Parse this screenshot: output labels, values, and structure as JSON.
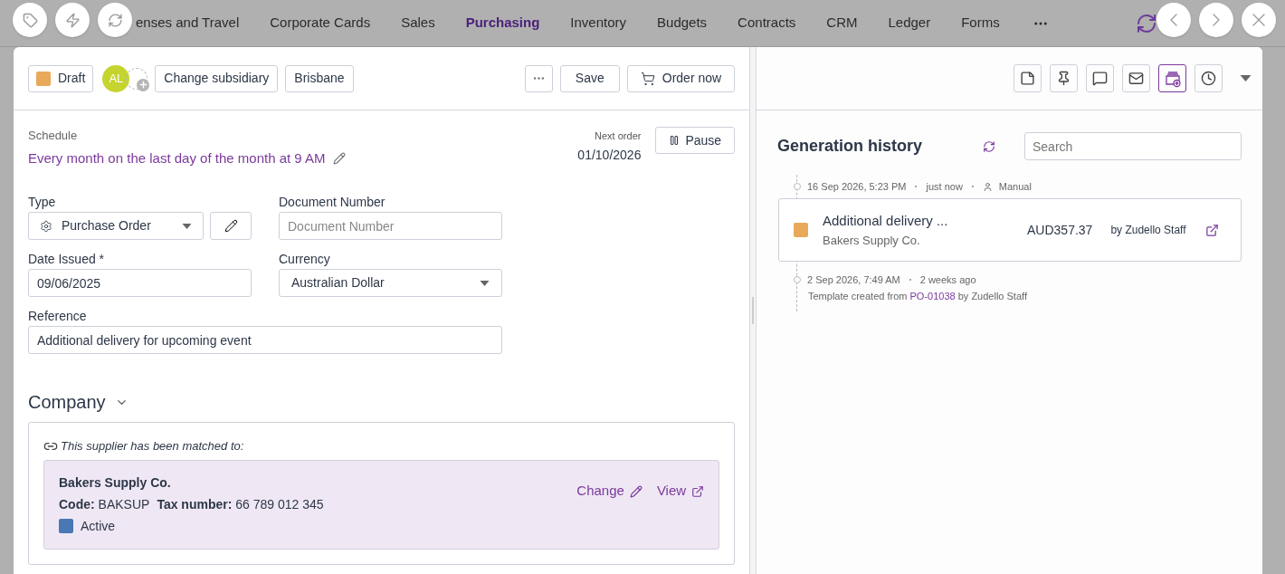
{
  "nav": {
    "items": [
      {
        "label": "enses and Travel",
        "selected": false
      },
      {
        "label": "Corporate Cards",
        "selected": false
      },
      {
        "label": "Sales",
        "selected": false
      },
      {
        "label": "Purchasing",
        "selected": true
      },
      {
        "label": "Inventory",
        "selected": false
      },
      {
        "label": "Budgets",
        "selected": false
      },
      {
        "label": "Contracts",
        "selected": false
      },
      {
        "label": "CRM",
        "selected": false
      },
      {
        "label": "Ledger",
        "selected": false
      },
      {
        "label": "Forms",
        "selected": false
      }
    ]
  },
  "header": {
    "status": {
      "label": "Draft",
      "color": "#e8a95b"
    },
    "avatar": "AL",
    "buttons": [
      "Change subsidiary",
      "Brisbane"
    ],
    "save": "Save",
    "order": "Order now"
  },
  "toolbar": [
    {
      "kind": "note",
      "selected": false
    },
    {
      "kind": "pin",
      "selected": false
    },
    {
      "kind": "comment",
      "selected": false
    },
    {
      "kind": "mail",
      "selected": false
    },
    {
      "kind": "generate",
      "selected": true
    },
    {
      "kind": "history",
      "selected": false
    }
  ],
  "schedule": {
    "label": "Schedule",
    "value": "Every month on the last day of the month at 9 AM",
    "next_label": "Next order",
    "next_value": "01/10/2026",
    "pause": "Pause"
  },
  "fields": {
    "type": {
      "label": "Type",
      "value": "Purchase Order"
    },
    "document_number": {
      "label": "Document Number",
      "placeholder": "Document Number"
    },
    "date_issued": {
      "label": "Date Issued *",
      "value": "09/06/2025"
    },
    "currency": {
      "label": "Currency",
      "value": "Australian Dollar"
    },
    "reference": {
      "label": "Reference",
      "value": "Additional delivery for upcoming event"
    }
  },
  "company": {
    "title": "Company",
    "matched": "This supplier has been matched to:",
    "name": "Bakers Supply Co.",
    "code": "**Code:** BAKSUP",
    "tax": "**Tax number:** 66 789 012 345",
    "status": {
      "label": "Active",
      "color": "#4a78b4"
    },
    "change": "Change",
    "view": "View"
  },
  "history": {
    "title": "Generation history",
    "search_placeholder": "Search",
    "entries": [
      {
        "kind": "generated",
        "date": "16 Sep 2026, 5:23 PM",
        "ago": "just now",
        "source": "Manual",
        "title": "Additional delivery ...",
        "supplier": "Bakers Supply Co.",
        "amount": "AUD357.37",
        "by": "by Zudello Staff",
        "color": "#e8a95b"
      },
      {
        "kind": "created",
        "date": "2 Sep 2026, 7:49 AM",
        "ago": "2 weeks ago",
        "prefix": "Template created from",
        "link": "PO-01038",
        "suffix": "by Zudello Staff"
      }
    ]
  }
}
